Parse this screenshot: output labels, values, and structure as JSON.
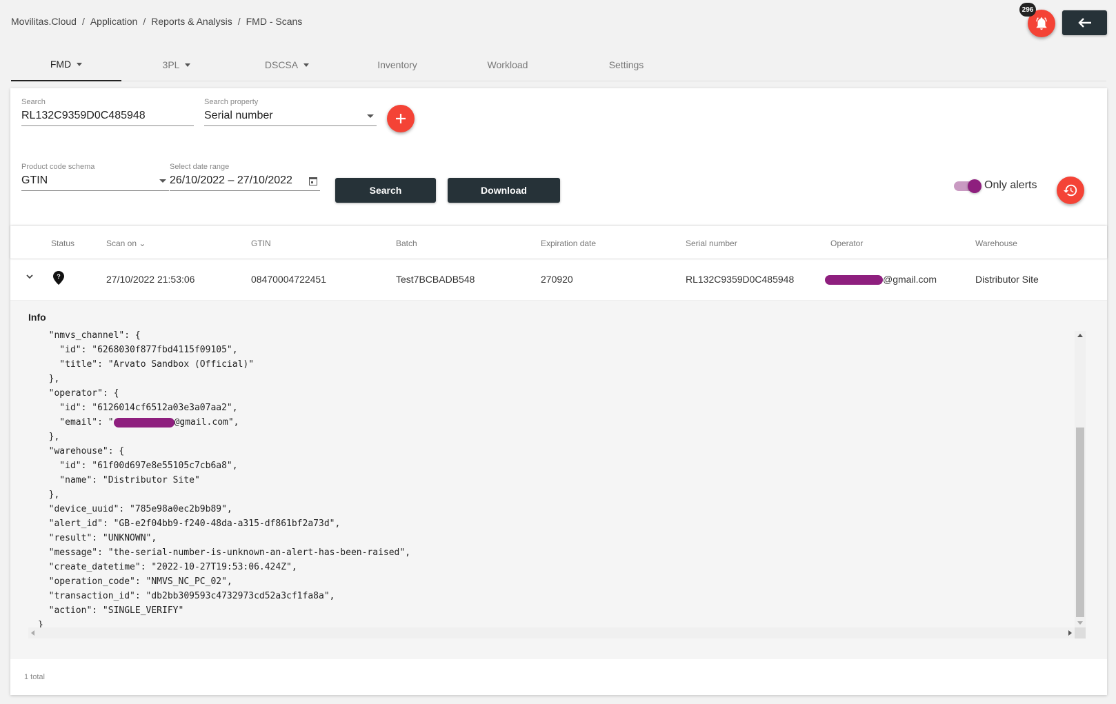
{
  "breadcrumb": [
    "Movilitas.Cloud",
    "Application",
    "Reports & Analysis",
    "FMD - Scans"
  ],
  "notifications": {
    "count": "296",
    "icon": "bell-icon"
  },
  "tabs": [
    {
      "label": "FMD"
    },
    {
      "label": "3PL"
    },
    {
      "label": "DSCSA"
    },
    {
      "label": "Inventory"
    },
    {
      "label": "Workload"
    },
    {
      "label": "Settings"
    }
  ],
  "filters": {
    "search_label": "Search",
    "search_value": "RL132C9359D0C485948",
    "property_label": "Search property",
    "property_value": "Serial number",
    "schema_label": "Product code schema",
    "schema_value": "GTIN",
    "date_label": "Select date range",
    "date_value": "26/10/2022 – 27/10/2022",
    "search_button": "Search",
    "download_button": "Download",
    "only_alerts_label": "Only alerts",
    "only_alerts_on": true
  },
  "table": {
    "headers": [
      "Status",
      "Scan on",
      "GTIN",
      "Batch",
      "Expiration date",
      "Serial number",
      "Operator",
      "Warehouse"
    ],
    "rows": [
      {
        "scan_on": "27/10/2022 21:53:06",
        "gtin": "08470004722451",
        "batch": "Test7BCBADB548",
        "expiration": "270920",
        "serial": "RL132C9359D0C485948",
        "operator_suffix": "@gmail.com",
        "warehouse": "Distributor Site"
      }
    ],
    "total": "1 total"
  },
  "info": {
    "title": "Info",
    "lines": [
      "  \"nmvs_channel\": {",
      "    \"id\": \"6268030f877fbd4115f09105\",",
      "    \"title\": \"Arvato Sandbox (Official)\"",
      "  },",
      "  \"operator\": {",
      "    \"id\": \"6126014cf6512a03e3a07aa2\",",
      "    \"email\": \"",
      "  },",
      "  \"warehouse\": {",
      "    \"id\": \"61f00d697e8e55105c7cb6a8\",",
      "    \"name\": \"Distributor Site\"",
      "  },",
      "  \"device_uuid\": \"785e98a0ec2b9b89\",",
      "  \"alert_id\": \"GB-e2f04bb9-f240-48da-a315-df861bf2a73d\",",
      "  \"result\": \"UNKNOWN\",",
      "  \"message\": \"the-serial-number-is-unknown-an-alert-has-been-raised\",",
      "  \"create_datetime\": \"2022-10-27T19:53:06.424Z\",",
      "  \"operation_code\": \"NMVS_NC_PC_02\",",
      "  \"transaction_id\": \"db2bb309593c4732973cd52a3cf1fa8a\",",
      "  \"action\": \"SINGLE_VERIFY\"",
      "}"
    ],
    "email_suffix": "@gmail.com\","
  },
  "colors": {
    "accent_red": "#f44336",
    "dark": "#263238",
    "toggle_purple": "#8e1f7e"
  }
}
